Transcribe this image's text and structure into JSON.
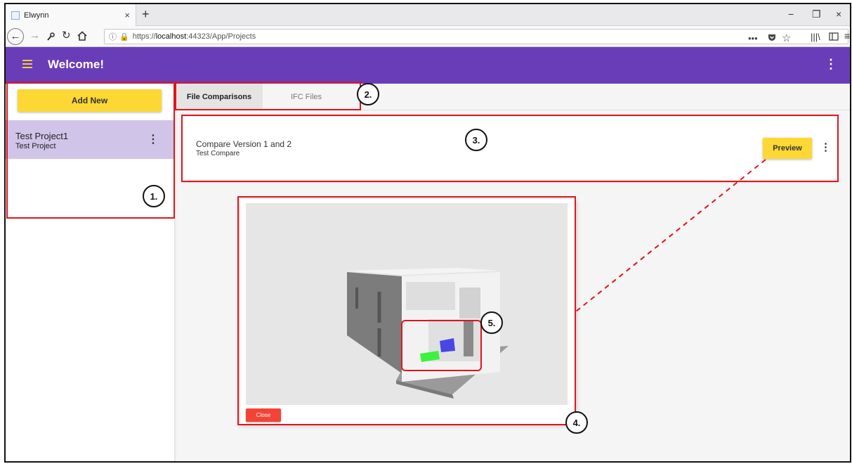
{
  "browser": {
    "tab_title": "Elwynn",
    "tab_close": "×",
    "new_tab": "+",
    "url_prefix": "https://",
    "url_host": "localhost",
    "url_path": ":44323/App/Projects",
    "window_controls": [
      "−",
      "❐",
      "×"
    ]
  },
  "appbar": {
    "title": "Welcome!"
  },
  "sidebar": {
    "add_new_label": "Add New",
    "projects": [
      {
        "name": "Test Project1",
        "description": "Test Project"
      }
    ]
  },
  "tabs": [
    {
      "label": "File Comparisons",
      "active": true
    },
    {
      "label": "IFC Files",
      "active": false
    }
  ],
  "comparison": {
    "title": "Compare Version 1 and 2",
    "description": "Test Compare",
    "preview_label": "Preview"
  },
  "viewer": {
    "close_label": "Close"
  },
  "annotations": {
    "labels": [
      "1.",
      "2.",
      "3.",
      "4.",
      "5."
    ],
    "color": "#e0151b"
  },
  "colors": {
    "primary": "#6a3db8",
    "accent": "#fdd835",
    "selected_project": "#d1c4e9",
    "danger": "#f44336"
  }
}
